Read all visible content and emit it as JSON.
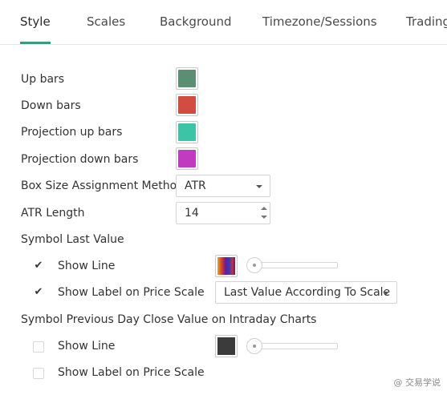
{
  "tabs": [
    {
      "label": "Style",
      "active": true
    },
    {
      "label": "Scales",
      "active": false
    },
    {
      "label": "Background",
      "active": false
    },
    {
      "label": "Timezone/Sessions",
      "active": false
    },
    {
      "label": "Trading",
      "active": false
    }
  ],
  "style": {
    "up_bars": {
      "label": "Up bars",
      "color": "#5b8f73"
    },
    "down_bars": {
      "label": "Down bars",
      "color": "#d24c42"
    },
    "projection_up_bars": {
      "label": "Projection up bars",
      "color": "#3cc4a6"
    },
    "projection_down_bars": {
      "label": "Projection down bars",
      "color": "#c13bc1"
    },
    "box_size_method": {
      "label": "Box Size Assignment Method",
      "value": "ATR"
    },
    "atr_length": {
      "label": "ATR Length",
      "value": "14"
    }
  },
  "symbol_last_value": {
    "heading": "Symbol Last Value",
    "show_line": {
      "label": "Show Line",
      "checked": true
    },
    "show_label": {
      "label": "Show Label on Price Scale",
      "checked": true,
      "select_value": "Last Value According To Scale"
    }
  },
  "prev_day_close": {
    "heading": "Symbol Previous Day Close Value on Intraday Charts",
    "show_line": {
      "label": "Show Line",
      "checked": false,
      "color": "#3b3b3b"
    },
    "show_label": {
      "label": "Show Label on Price Scale",
      "checked": false
    }
  },
  "watermark": "@ 交易学说"
}
